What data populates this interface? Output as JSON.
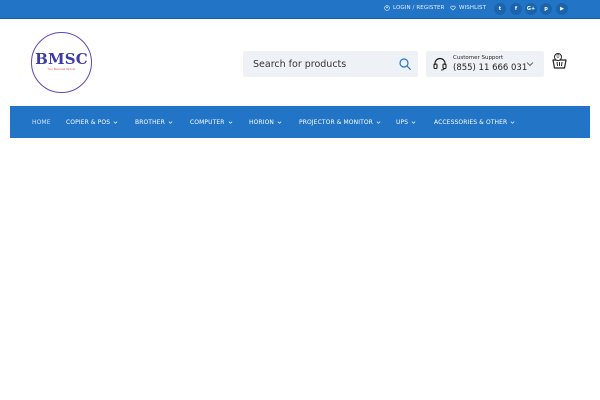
{
  "topbar": {
    "login_label": "LOGIN / REGISTER",
    "wishlist_label": "WISHLIST",
    "social": [
      {
        "icon": "twitter-icon",
        "glyph": "t"
      },
      {
        "icon": "facebook-icon",
        "glyph": "f"
      },
      {
        "icon": "google-plus-icon",
        "glyph": "G+"
      },
      {
        "icon": "pinterest-icon",
        "glyph": "p"
      },
      {
        "icon": "youtube-icon",
        "glyph": "▶"
      }
    ]
  },
  "logo": {
    "text": "BMSC",
    "subtext": "Your Business Partner"
  },
  "search": {
    "placeholder": "Search for products"
  },
  "support": {
    "label": "Customer Support",
    "phone": "(855) 11 666 031"
  },
  "cart": {
    "count": "0"
  },
  "nav": {
    "items": [
      {
        "label": "HOME",
        "active": true,
        "has_dropdown": false
      },
      {
        "label": "COPIER & POS",
        "has_dropdown": true
      },
      {
        "label": "BROTHER",
        "has_dropdown": true
      },
      {
        "label": "COMPUTER",
        "has_dropdown": true
      },
      {
        "label": "HORION",
        "has_dropdown": true
      },
      {
        "label": "PROJECTOR & MONITOR",
        "has_dropdown": true
      },
      {
        "label": "UPS",
        "has_dropdown": true
      },
      {
        "label": "ACCESSORIES & OTHER",
        "has_dropdown": true
      }
    ]
  },
  "colors": {
    "brand_blue": "#2275c6",
    "logo_purple": "#3d3ba8",
    "search_bg": "#eef1f5"
  }
}
